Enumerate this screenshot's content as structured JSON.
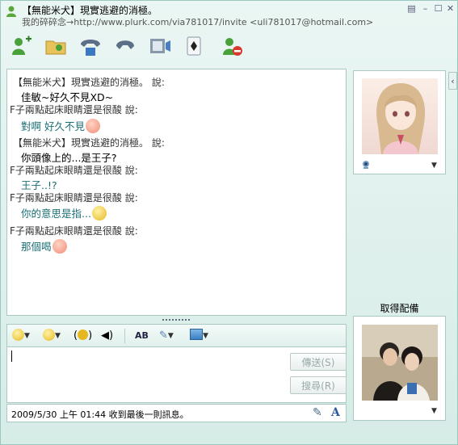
{
  "window": {
    "title": "【無能米犬】現實逃避的消極。",
    "subtitle": "我的碎碎念→http://www.plurk.com/via781017/invite <uli781017@hotmail.com>"
  },
  "toolbar": {
    "icons": [
      "add-contact-icon",
      "share-files-icon",
      "video-call-icon",
      "voice-call-icon",
      "video-icon",
      "games-icon",
      "block-icon"
    ]
  },
  "chat": {
    "lines": [
      {
        "type": "sender",
        "text": "【無能米犬】現實逃避的消極。 說:"
      },
      {
        "type": "message",
        "text": "佳敏~好久不見XD~"
      },
      {
        "type": "sender",
        "text": "F子兩點起床眼睛還是很酸 說:"
      },
      {
        "type": "message",
        "text": "對啊 好久不見"
      },
      {
        "type": "sender",
        "text": "【無能米犬】現實逃避的消極。 說:"
      },
      {
        "type": "message",
        "text": "你頭像上的...是王子?"
      },
      {
        "type": "sender",
        "text": "F子兩點起床眼睛還是很酸 說:"
      },
      {
        "type": "message",
        "text": "王子..!?"
      },
      {
        "type": "sender",
        "text": "F子兩點起床眼睛還是很酸 說:"
      },
      {
        "type": "message",
        "text": "你的意思是指..."
      },
      {
        "type": "sender",
        "text": "F子兩點起床眼睛還是很酸 說:"
      },
      {
        "type": "message",
        "text": "那個喝"
      }
    ]
  },
  "format_toolbar": {
    "icons": [
      "emoticon-icon",
      "wink-icon",
      "nudge-icon",
      "voice-clip-icon",
      "font-icon",
      "background-icon",
      "theme-icon"
    ]
  },
  "input": {
    "send_label": "傳送(S)",
    "search_label": "搜尋(R)"
  },
  "status": {
    "text": "2009/5/30 上午 01:44 收到最後一則訊息。"
  },
  "side": {
    "get_accessory_label": "取得配備"
  },
  "colors": {
    "window_bg": "#d6ece7",
    "chat_reply": "#1a6e73",
    "border": "#aac9c3"
  }
}
